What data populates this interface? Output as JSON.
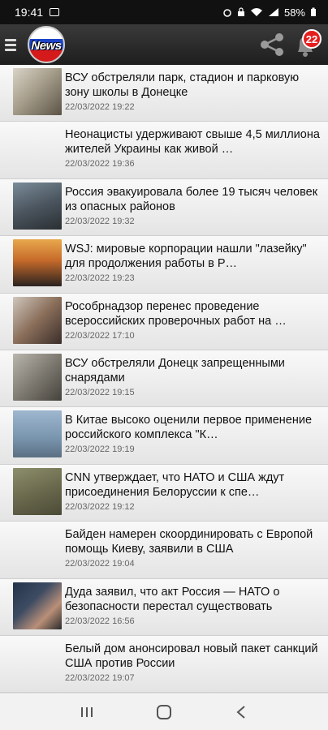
{
  "status_bar": {
    "time": "19:41",
    "battery": "58%"
  },
  "app_bar": {
    "logo_text": "News",
    "notification_count": "22"
  },
  "feed": {
    "items": [
      {
        "title": "ВСУ обстреляли парк, стадион и парковую зону школы в Донецке",
        "date": "22/03/2022 19:22",
        "has_image": true
      },
      {
        "title": "Неонацисты удерживают свыше 4,5 миллиона жителей Украины как живой …",
        "date": "22/03/2022 19:36",
        "has_image": false
      },
      {
        "title": "Россия эвакуировала более 19 тысяч человек из опасных районов",
        "date": "22/03/2022 19:32",
        "has_image": true
      },
      {
        "title": "WSJ: мировые корпорации нашли \"лазейку\" для продолжения работы в Р…",
        "date": "22/03/2022 19:23",
        "has_image": true
      },
      {
        "title": "Рособрнадзор перенес проведение всероссийских проверочных работ на …",
        "date": "22/03/2022 17:10",
        "has_image": true
      },
      {
        "title": "ВСУ обстреляли Донецк запрещенными снарядами",
        "date": "22/03/2022 19:15",
        "has_image": true
      },
      {
        "title": "В Китае высоко оценили первое применение российского комплекса \"К…",
        "date": "22/03/2022 19:19",
        "has_image": true
      },
      {
        "title": "CNN утверждает, что НАТО и США ждут присоединения Белоруссии к спе…",
        "date": "22/03/2022 19:12",
        "has_image": true
      },
      {
        "title": "Байден намерен скоординировать с Европой помощь Киеву, заявили в США",
        "date": "22/03/2022 19:04",
        "has_image": false
      },
      {
        "title": "Дуда заявил, что акт Россия — НАТО о безопасности перестал существовать",
        "date": "22/03/2022 16:56",
        "has_image": true
      },
      {
        "title": "Белый дом анонсировал новый пакет санкций США против России",
        "date": "22/03/2022 19:07",
        "has_image": false
      }
    ]
  },
  "thumbs": [
    "linear-gradient(135deg,#d9d4c8 0%,#a79f8c 45%,#5b5346 100%)",
    "",
    "linear-gradient(160deg,#7a8c99 0%,#4c5660 50%,#2a2f33 100%)",
    "linear-gradient(180deg,#e8a84d 0%,#c66a2a 45%,#2b2320 100%)",
    "linear-gradient(135deg,#cfc7bd 0%,#8a6e5a 50%,#3a2e2a 100%)",
    "linear-gradient(135deg,#b9b6ae 0%,#7f7b72 50%,#45423d 100%)",
    "linear-gradient(180deg,#9fb7cf 0%,#7894ad 60%,#5b6f82 100%)",
    "linear-gradient(160deg,#8d8f6c 0%,#6b6a4e 50%,#4b4a36 100%)",
    "",
    "linear-gradient(135deg,#23324a 0%,#3e4c63 40%,#b98f78 70%,#2b2b2b 100%)",
    ""
  ],
  "nav": {
    "recents_icon": "recents-icon",
    "home_icon": "home-icon",
    "back_icon": "back-icon"
  }
}
